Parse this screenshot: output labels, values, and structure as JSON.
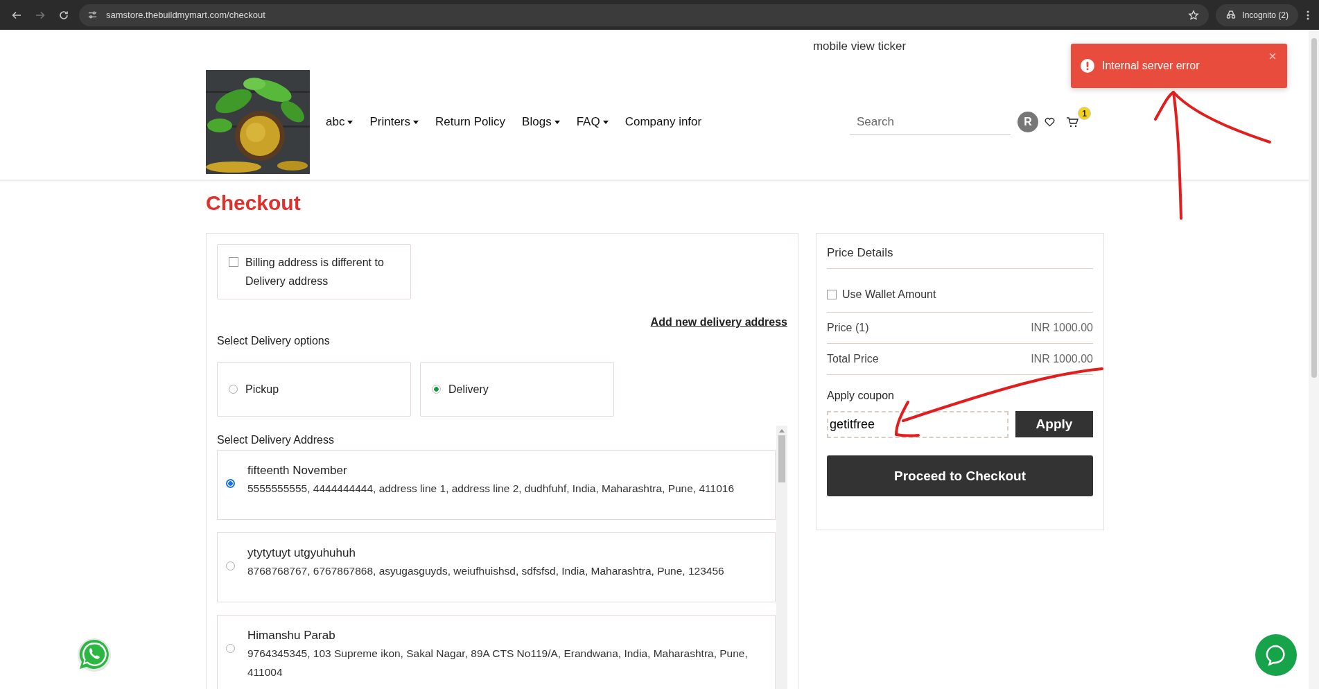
{
  "browser": {
    "url": "samstore.thebuildmymart.com/checkout",
    "profile": "Incognito (2)"
  },
  "ticker": "mobile view ticker",
  "nav": [
    {
      "label": "abc",
      "dropdown": true
    },
    {
      "label": "Printers",
      "dropdown": true
    },
    {
      "label": "Return Policy",
      "dropdown": false
    },
    {
      "label": "Blogs",
      "dropdown": true
    },
    {
      "label": "FAQ",
      "dropdown": true
    },
    {
      "label": "Company infor",
      "dropdown": false
    }
  ],
  "search": {
    "placeholder": "Search"
  },
  "user": {
    "initial": "R"
  },
  "cart": {
    "count": "1"
  },
  "toast": {
    "message": "Internal server error"
  },
  "page_title": "Checkout",
  "billing": {
    "label": "Billing address is different to Delivery address",
    "checked": false
  },
  "add_address_link": "Add new delivery address",
  "delivery_options": {
    "title": "Select Delivery options",
    "options": [
      {
        "label": "Pickup",
        "selected": false
      },
      {
        "label": "Delivery",
        "selected": true
      }
    ]
  },
  "addresses": {
    "title": "Select Delivery Address",
    "items": [
      {
        "name": "fifteenth November",
        "details": "5555555555, 4444444444, address line 1, address line 2, dudhfuhf, India, Maharashtra, Pune, 411016",
        "selected": true
      },
      {
        "name": "ytytytuyt utgyuhuhuh",
        "details": "8768768767, 6767867868, asyugasguyds, weiufhuishsd, sdfsfsd, India, Maharashtra, Pune, 123456",
        "selected": false
      },
      {
        "name": "Himanshu Parab",
        "details": "9764345345, 103 Supreme ikon, Sakal Nagar, 89A CTS No119/A, Erandwana, India, Maharashtra, Pune, 411004",
        "selected": false
      }
    ]
  },
  "price_details": {
    "title": "Price Details",
    "wallet": {
      "label": "Use Wallet Amount",
      "checked": false
    },
    "rows": [
      {
        "label": "Price (1)",
        "value": "INR 1000.00"
      },
      {
        "label": "Total Price",
        "value": "INR 1000.00"
      }
    ],
    "coupon": {
      "label": "Apply coupon",
      "value": "getitfree",
      "button": "Apply"
    },
    "checkout_button": "Proceed to Checkout"
  }
}
